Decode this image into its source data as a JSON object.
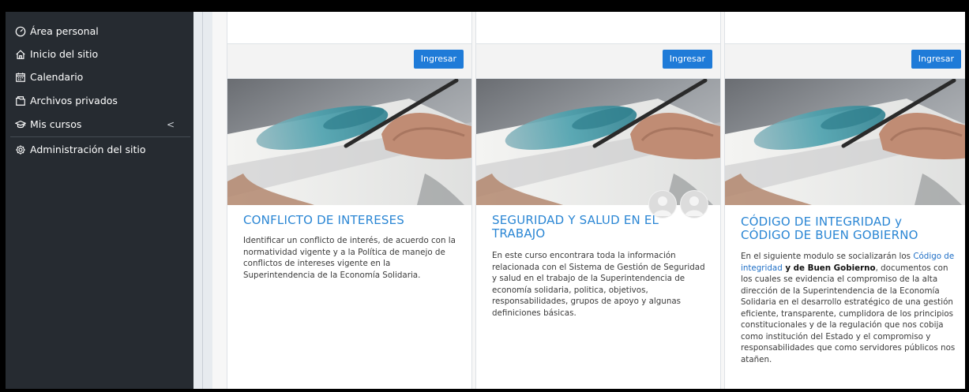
{
  "sidebar": {
    "items": [
      {
        "label": "Área personal",
        "icon": "dashboard-icon"
      },
      {
        "label": "Inicio del sitio",
        "icon": "home-icon"
      },
      {
        "label": "Calendario",
        "icon": "calendar-icon"
      },
      {
        "label": "Archivos privados",
        "icon": "files-icon"
      },
      {
        "label": "Mis cursos",
        "icon": "graduation-cap-icon",
        "chevron": "<"
      },
      {
        "label": "Administración del sitio",
        "icon": "cog-icon"
      }
    ]
  },
  "cards": [
    {
      "button": "Ingresar",
      "title": "CONFLICTO DE INTERESES",
      "text": "Identificar un conflicto de interés, de acuerdo con la normatividad vigente y a la Política de manejo de conflictos de intereses vigente en la Superintendencia de la Economía Solidaria."
    },
    {
      "button": "Ingresar",
      "title": "SEGURIDAD Y SALUD EN EL TRABAJO",
      "text": "En este curso encontrara toda la información relacionada con el Sistema de Gestión de Seguridad y salud en el trabajo de la Superintendencia de economía solidaria, politica, objetivos, responsabilidades, grupos de apoyo y algunas definiciones básicas."
    },
    {
      "button": "Ingresar",
      "title": "CÓDIGO DE INTEGRIDAD y CÓDIGO DE BUEN GOBIERNO",
      "text_before": "En el siguiente modulo  se socializarán los ",
      "text_link": "Código de integridad",
      "text_bold": " y de Buen Gobierno",
      "text_after": ", documentos con los cuales se evidencia el compromiso de la alta dirección de la Superintendencia de la Economía Solidaria en el desarrollo estratégico de una gestión eficiente, transparente, cumplidora de los principios constitucionales y de la regulación que nos cobija como institución del Estado y el compromiso y responsabilidades que como servidores públicos nos atañen."
    }
  ],
  "colors": {
    "sidebar_bg": "#262b31",
    "accent_blue": "#1f7bd8",
    "title_blue": "#2a86d4"
  }
}
